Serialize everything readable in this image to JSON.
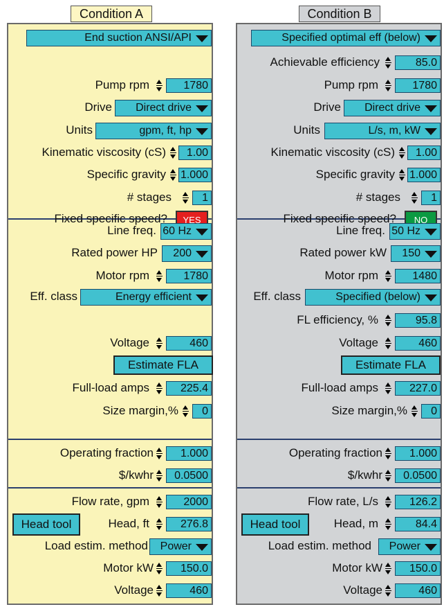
{
  "conditionA": {
    "title": "Condition A",
    "pump_type": "End suction ANSI/API",
    "pump_rpm_label": "Pump rpm",
    "pump_rpm": "1780",
    "drive_label": "Drive",
    "drive": "Direct drive",
    "units_label": "Units",
    "units": "gpm, ft, hp",
    "visc_label": "Kinematic viscosity (cS)",
    "visc": "1.00",
    "sg_label": "Specific gravity",
    "sg": "1.000",
    "stages_label": "# stages",
    "stages": "1",
    "fss_label": "Fixed specific speed?",
    "fss": "YES",
    "line_freq_label": "Line freq.",
    "line_freq": "60 Hz",
    "rated_power_label": "Rated power HP",
    "rated_power": "200",
    "motor_rpm_label": "Motor rpm",
    "motor_rpm": "1780",
    "eff_class_label": "Eff. class",
    "eff_class": "Energy efficient",
    "voltage_label": "Voltage",
    "voltage": "460",
    "estimate_fla": "Estimate FLA",
    "fla_label": "Full-load amps",
    "fla": "225.4",
    "size_margin_label": "Size margin,%",
    "size_margin": "0",
    "op_fraction_label": "Operating fraction",
    "op_fraction": "1.000",
    "kwhr_label": "$/kwhr",
    "kwhr": "0.0500",
    "flow_label": "Flow rate, gpm",
    "flow": "2000",
    "head_tool": "Head tool",
    "head_label": "Head, ft",
    "head": "276.8",
    "load_method_label": "Load estim. method",
    "load_method": "Power",
    "motor_kw_label": "Motor kW",
    "motor_kw": "150.0",
    "voltage2_label": "Voltage",
    "voltage2": "460"
  },
  "conditionB": {
    "title": "Condition B",
    "pump_type": "Specified optimal eff (below)",
    "ach_eff_label": "Achievable efficiency",
    "ach_eff": "85.0",
    "pump_rpm_label": "Pump rpm",
    "pump_rpm": "1780",
    "drive_label": "Drive",
    "drive": "Direct drive",
    "units_label": "Units",
    "units": "L/s, m, kW",
    "visc_label": "Kinematic viscosity (cS)",
    "visc": "1.00",
    "sg_label": "Specific gravity",
    "sg": "1.000",
    "stages_label": "# stages",
    "stages": "1",
    "fss_label": "Fixed specific speed?",
    "fss": "NO",
    "line_freq_label": "Line freq.",
    "line_freq": "50 Hz",
    "rated_power_label": "Rated power kW",
    "rated_power": "150",
    "motor_rpm_label": "Motor rpm",
    "motor_rpm": "1480",
    "eff_class_label": "Eff. class",
    "eff_class": "Specified (below)",
    "fl_eff_label": "FL efficiency, %",
    "fl_eff": "95.8",
    "voltage_label": "Voltage",
    "voltage": "460",
    "estimate_fla": "Estimate FLA",
    "fla_label": "Full-load amps",
    "fla": "227.0",
    "size_margin_label": "Size margin,%",
    "size_margin": "0",
    "op_fraction_label": "Operating fraction",
    "op_fraction": "1.000",
    "kwhr_label": "$/kwhr",
    "kwhr": "0.0500",
    "flow_label": "Flow rate, L/s",
    "flow": "126.2",
    "head_tool": "Head tool",
    "head_label": "Head, m",
    "head": "84.4",
    "load_method_label": "Load estim. method",
    "load_method": "Power",
    "motor_kw_label": "Motor kW",
    "motor_kw": "150.0",
    "voltage2_label": "Voltage",
    "voltage2": "460"
  },
  "colors": {
    "panel_a_bg": "#faf4b9",
    "panel_b_bg": "#d2d4d6",
    "field": "#41c1cf",
    "yes": "#e51f1f",
    "no": "#0b9a42"
  }
}
